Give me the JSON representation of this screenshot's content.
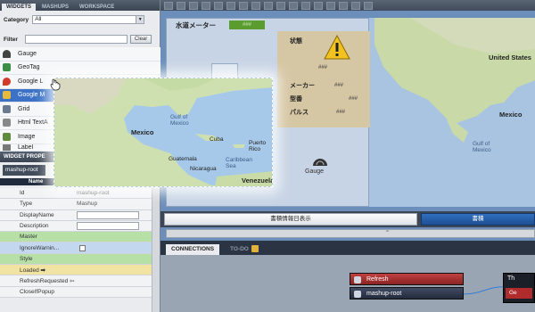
{
  "left_tabs": [
    "WIDGETS",
    "MASHUPS",
    "WORKSPACE"
  ],
  "category": {
    "label": "Category",
    "value": "All"
  },
  "filter": {
    "label": "Filter",
    "clear_label": "Clear"
  },
  "widgets": [
    {
      "label": "Gauge",
      "icon": "gauge-icon",
      "color": "#444444"
    },
    {
      "label": "GeoTag",
      "icon": "geotag-icon",
      "color": "#3a8f45"
    },
    {
      "label": "Google L",
      "icon": "map-pin-icon",
      "color": "#d23a2a"
    },
    {
      "label": "Google M",
      "icon": "map-icon",
      "color": "#3b72c6",
      "selected": true
    },
    {
      "label": "Grid",
      "icon": "grid-icon",
      "color": "#6a7b8f"
    },
    {
      "label": "Html TextA",
      "icon": "html-textarea-icon",
      "color": "#888888"
    },
    {
      "label": "Image",
      "icon": "image-icon",
      "color": "#5e8c3a"
    },
    {
      "label": "Label",
      "icon": "label-icon",
      "color": "#777777"
    }
  ],
  "widget_props": {
    "title": "WIDGET PROPE",
    "root_label": "mashup-root",
    "name_col": "Name",
    "rows": [
      {
        "key": "Id",
        "value": "mashup-root",
        "style": ""
      },
      {
        "key": "Type",
        "value": "Mashup",
        "style": ""
      },
      {
        "key": "DisplayName",
        "value": "",
        "style": "",
        "input": true
      },
      {
        "key": "Description",
        "value": "",
        "style": "",
        "input": true
      },
      {
        "key": "Master",
        "value": "",
        "style": "green"
      },
      {
        "key": "IgnoreWarnin...",
        "value": "",
        "style": "blue",
        "checkbox": true
      },
      {
        "key": "Style",
        "value": "",
        "style": "green"
      },
      {
        "key": "Loaded",
        "value": "",
        "style": "yellow",
        "arrow": true
      },
      {
        "key": "RefreshRequested",
        "value": "",
        "style": "",
        "arrow": true
      },
      {
        "key": "CloseIfPopup",
        "value": "",
        "style": ""
      }
    ]
  },
  "dashboard": {
    "title": "水道メーター",
    "title_value": "###",
    "status_label": "状態",
    "status_value": "###",
    "maker_label": "メーカー",
    "maker_value": "###",
    "model_label": "型番",
    "model_value": "###",
    "pulse_label": "パルス",
    "pulse_value": "###",
    "gauge_label": "Gauge"
  },
  "bottom_tabs": [
    "書積情報日表示",
    "書積"
  ],
  "hscroll_label": "'''",
  "conn_tabs": {
    "connections": "CONNECTIONS",
    "todo": "TO-DO"
  },
  "conn_nodes": {
    "refresh": "Refresh",
    "mashup_root": "mashup-root",
    "panel_top": "Th",
    "panel_bottom": "Ge"
  },
  "map_labels": {
    "united_states": "United States",
    "mexico": "Mexico",
    "mexico_big": "Mexico",
    "gulf_of_mexico": "Gulf of Mexico",
    "cuba": "Cuba",
    "puerto_rico": "Puerto Rico",
    "guatemala": "Guatemala",
    "nicaragua": "Nicaragua",
    "caribbean": "Caribbean Sea",
    "venezuela": "Venezuela",
    "gulf_of_mexico_big": "Gulf of Mexico",
    "the": "The"
  }
}
